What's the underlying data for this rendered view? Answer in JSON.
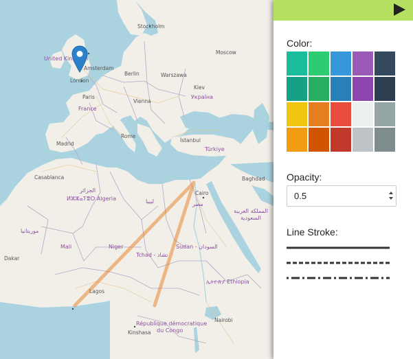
{
  "map": {
    "labels": {
      "stockholm": "Stockholm",
      "moscow": "Moscow",
      "united_kingdom": "United Kingdom",
      "amsterdam": "Amsterdam",
      "berlin": "Berlin",
      "london": "London",
      "warszawa": "Warszawa",
      "kiev": "Kiev",
      "ukraina": "Україна",
      "paris": "Paris",
      "france": "France",
      "vienna": "Vienna",
      "madrid": "Madrid",
      "rome": "Rome",
      "istanbul": "İstanbul",
      "turkiye": "Türkiye",
      "casablanca": "Casablanca",
      "baghdad": "Baghdad",
      "algeria_ar": "الجزائر",
      "algeria": "ⵍⵣⵣⴰⵢⴻⵔ Algeria",
      "libya": "ليبيا",
      "cairo": "Cairo",
      "misr": "مصر",
      "saudi_ar": "المملكة العربية السعودية",
      "mauritania": "موريتانيا",
      "mali": "Mali",
      "niger": "Niger",
      "tchad": "Tchad - تشاد",
      "sudan": "Sudan - السودان",
      "dakar": "Dakar",
      "lagos": "Lagos",
      "ethiopia": "ኢትዮጵያ Ethiopia",
      "nairobi": "Nairobi",
      "drc_1": "République démocratique",
      "drc_2": "du Congo",
      "kinshasa": "Kinshasa"
    }
  },
  "panel": {
    "color_label": "Color:",
    "opacity_label": "Opacity:",
    "opacity_value": "0.5",
    "stroke_label": "Line Stroke:",
    "swatches": [
      "#1abc9c",
      "#2ecc71",
      "#3498db",
      "#9b59b6",
      "#34495e",
      "#16a085",
      "#27ae60",
      "#2980b9",
      "#8e44ad",
      "#2c3e50",
      "#f1c40f",
      "#e67e22",
      "#e74c3c",
      "#ecf0f1",
      "#95a5a6",
      "#f39c12",
      "#d35400",
      "#c0392b",
      "#bdc3c7",
      "#7f8c8d"
    ],
    "header_color": "#b5e061",
    "drawn_line_color": "#e67e22"
  }
}
